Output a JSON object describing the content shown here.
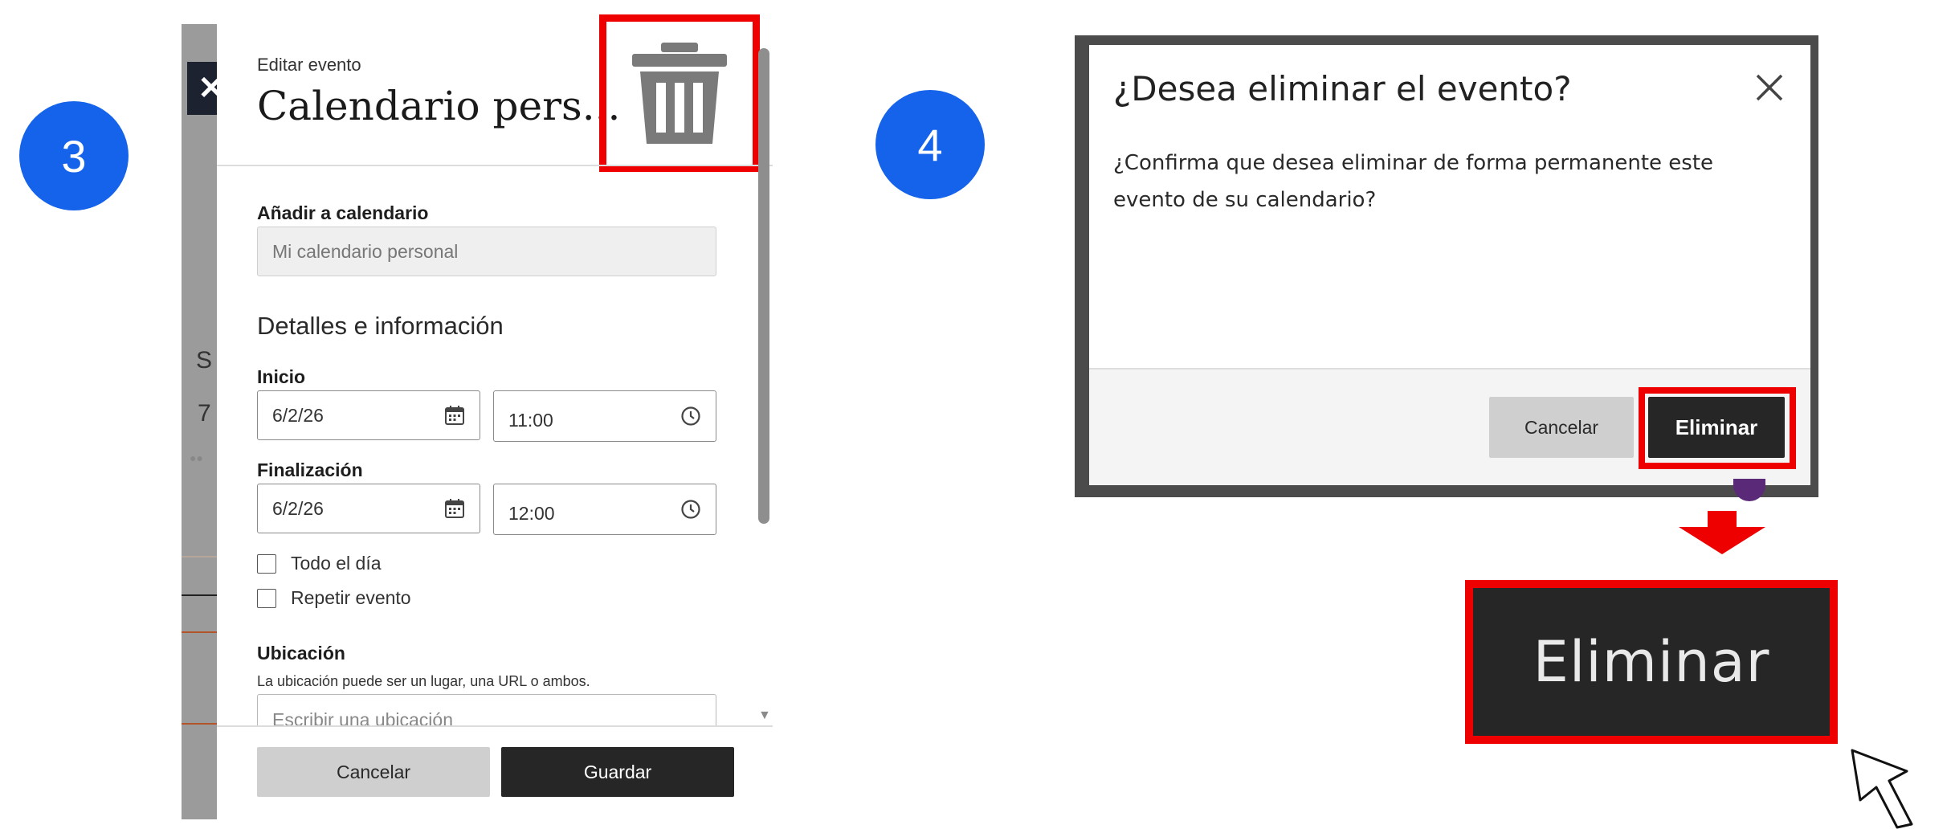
{
  "steps": {
    "three": "3",
    "four": "4"
  },
  "background_letters": {
    "day_letter": "S",
    "day_number": "7"
  },
  "panel3": {
    "close_glyph": "✕",
    "kicker": "Editar evento",
    "title": "Calendario pers...",
    "add_to_calendar_label": "Añadir a calendario",
    "add_to_calendar_value": "Mi calendario personal",
    "details_heading": "Detalles e información",
    "start_label": "Inicio",
    "start_date": "6/2/26",
    "start_time": "11:00",
    "end_label": "Finalización",
    "end_date": "6/2/26",
    "end_time": "12:00",
    "all_day_label": "Todo el día",
    "repeat_label": "Repetir evento",
    "location_label": "Ubicación",
    "location_hint": "La ubicación puede ser un lugar, una URL o ambos.",
    "location_placeholder": "Escribir una ubicación",
    "cancel_label": "Cancelar",
    "save_label": "Guardar",
    "icons": {
      "trash": "trash-icon",
      "calendar": "calendar-icon",
      "clock": "clock-icon"
    }
  },
  "panel4": {
    "title": "¿Desea eliminar el evento?",
    "body": "¿Confirma que desea eliminar de forma permanente este evento de su calendario?",
    "cancel_label": "Cancelar",
    "delete_label": "Eliminar",
    "zoom_delete_label": "Eliminar",
    "background_fragment": "i"
  },
  "colors": {
    "step_badge": "#1463ea",
    "highlight": "#ee0000",
    "dark_button": "#262626",
    "grey_button": "#cfcfcf"
  }
}
